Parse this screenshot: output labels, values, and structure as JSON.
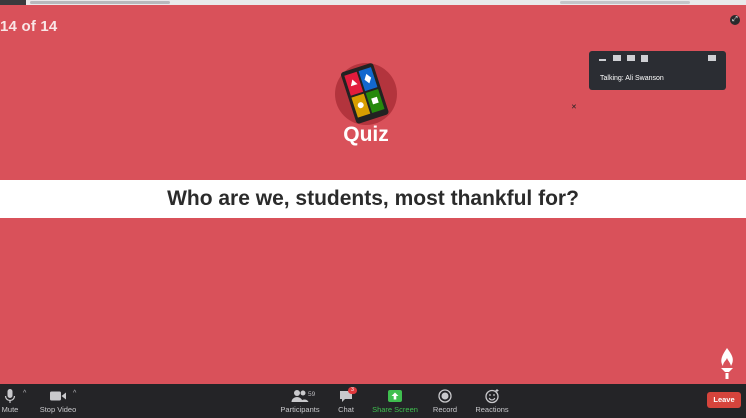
{
  "slide": {
    "counter": "14 of 14",
    "logo_text": "Quiz",
    "question": "Who are we, students, most thankful for?"
  },
  "mini_window": {
    "talking": "Talking: Ali Swanson"
  },
  "toolbar": {
    "mute": "Mute",
    "stop_video": "Stop Video",
    "participants": "Participants",
    "participants_count": "59",
    "chat": "Chat",
    "chat_badge": "3",
    "share_screen": "Share Screen",
    "record": "Record",
    "reactions": "Reactions",
    "leave": "Leave"
  },
  "colors": {
    "slide_bg": "#d9515a",
    "toolbar_bg": "#242427",
    "share_green": "#3fbf4f",
    "leave_red": "#d6443c"
  },
  "icons": [
    "microphone-icon",
    "video-camera-icon",
    "participants-icon",
    "chat-icon",
    "share-screen-icon",
    "record-icon",
    "reactions-icon",
    "fullscreen-icon",
    "kahoot-quiz-icon",
    "torch-icon"
  ]
}
